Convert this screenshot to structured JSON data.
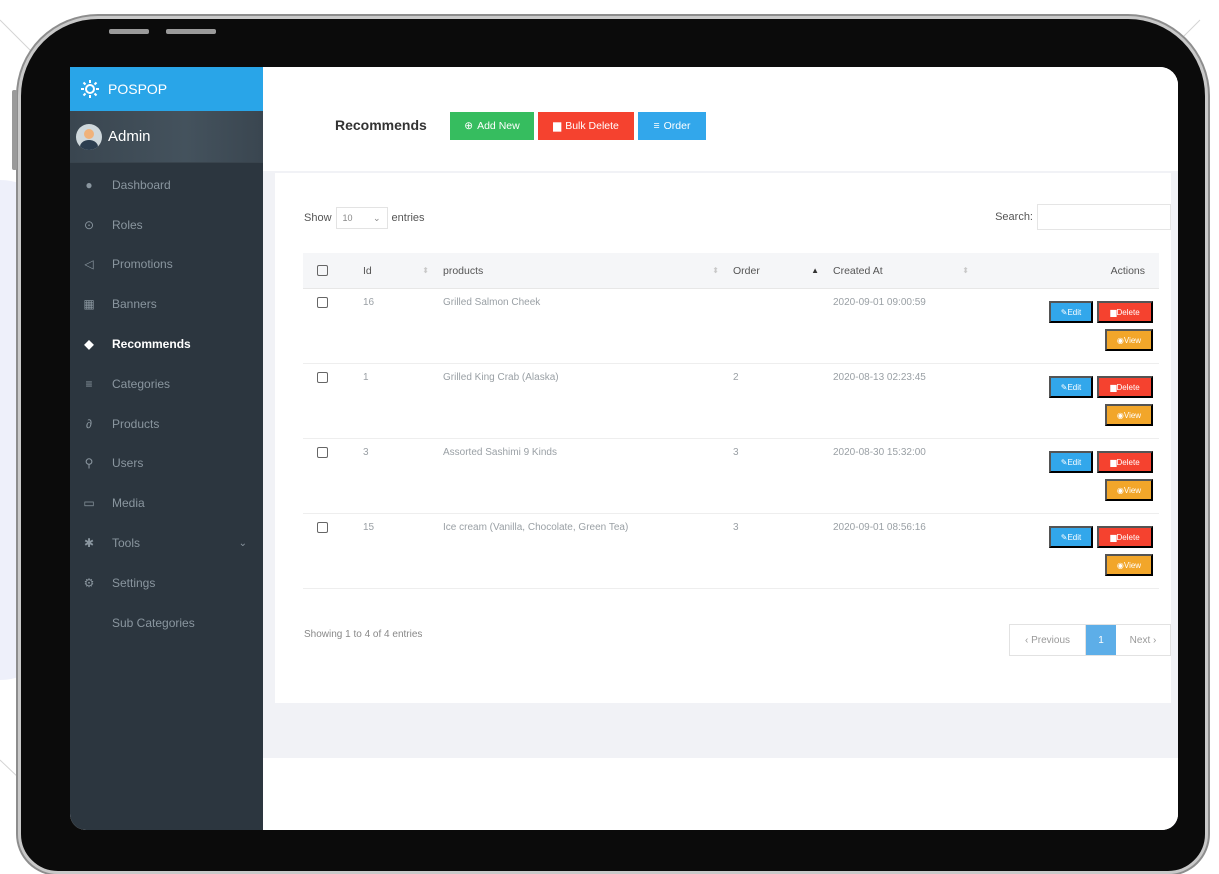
{
  "brand": {
    "name": "POSPOP"
  },
  "user": {
    "name": "Admin"
  },
  "nav": [
    {
      "label": "Dashboard",
      "icon": "dashboard-icon",
      "glyph": "●"
    },
    {
      "label": "Roles",
      "icon": "lock-icon",
      "glyph": "⊙"
    },
    {
      "label": "Promotions",
      "icon": "megaphone-icon",
      "glyph": "◁"
    },
    {
      "label": "Banners",
      "icon": "image-icon",
      "glyph": "▦"
    },
    {
      "label": "Recommends",
      "icon": "tag-icon",
      "glyph": "◆"
    },
    {
      "label": "Categories",
      "icon": "list-icon",
      "glyph": "≡"
    },
    {
      "label": "Products",
      "icon": "wrench-icon",
      "glyph": "∂"
    },
    {
      "label": "Users",
      "icon": "user-icon",
      "glyph": "⚲"
    },
    {
      "label": "Media",
      "icon": "media-icon",
      "glyph": "▭"
    },
    {
      "label": "Tools",
      "icon": "tools-icon",
      "glyph": "✱"
    },
    {
      "label": "Settings",
      "icon": "gear-icon",
      "glyph": "⚙"
    },
    {
      "label": "Sub Categories"
    }
  ],
  "page": {
    "title": "Recommends",
    "add_new": "Add New",
    "bulk_delete": "Bulk Delete",
    "order": "Order"
  },
  "table_controls": {
    "show": "Show",
    "entries_value": "10",
    "entries": "entries",
    "search": "Search:"
  },
  "table": {
    "headers": [
      "Id",
      "products",
      "Order",
      "Created At",
      "Actions"
    ],
    "rows": [
      {
        "id": "16",
        "product": "Grilled Salmon Cheek",
        "order": "",
        "created": "2020-09-01 09:00:59"
      },
      {
        "id": "1",
        "product": "Grilled King Crab (Alaska)",
        "order": "2",
        "created": "2020-08-13 02:23:45"
      },
      {
        "id": "3",
        "product": "Assorted Sashimi 9 Kinds",
        "order": "3",
        "created": "2020-08-30 15:32:00"
      },
      {
        "id": "15",
        "product": "Ice cream (Vanilla, Chocolate, Green Tea)",
        "order": "3",
        "created": "2020-09-01 08:56:16"
      }
    ],
    "actions": {
      "edit": "Edit",
      "delete": "Delete",
      "view": "View"
    }
  },
  "footer": {
    "info": "Showing 1 to 4 of 4 entries",
    "previous": "‹ Previous",
    "current_page": "1",
    "next": "Next ›"
  },
  "colors": {
    "sidebar": "#2c363f",
    "brand": "#29a5e8",
    "green": "#36bd5f",
    "red": "#f5422f",
    "blue": "#32a7eb",
    "orange": "#f2a62a"
  }
}
